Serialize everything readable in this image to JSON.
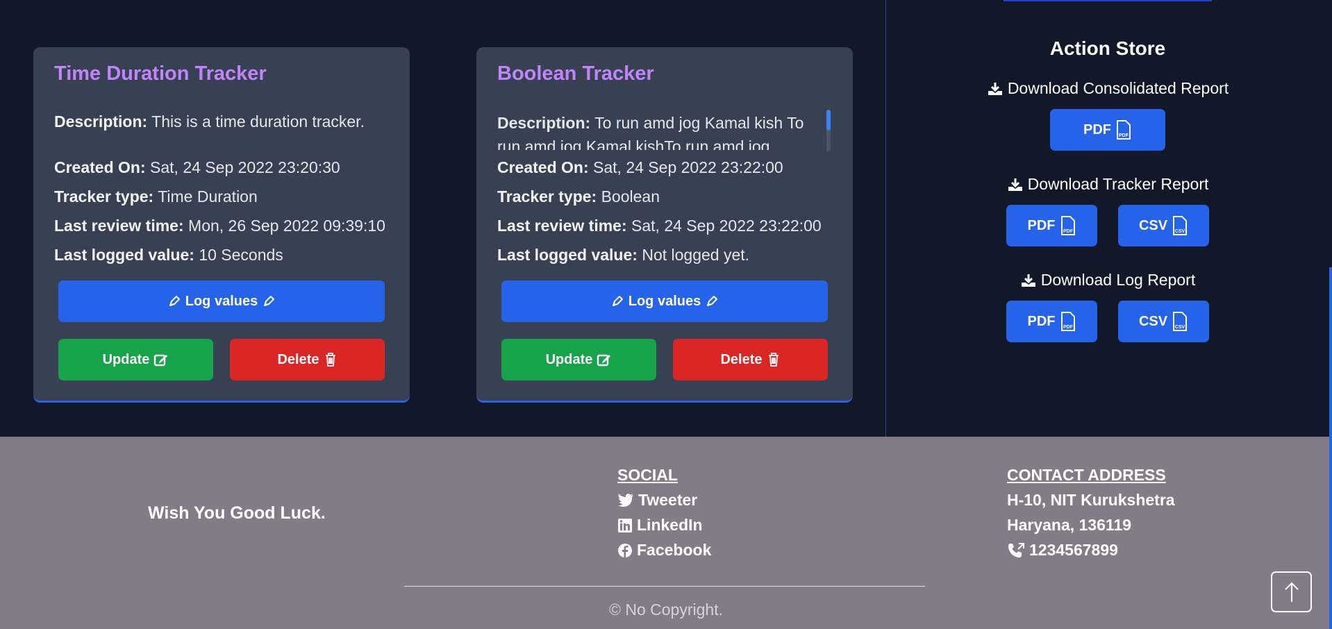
{
  "cards": [
    {
      "title": "Time Duration Tracker",
      "description_label": "Description:",
      "description": "This is a time duration tracker.",
      "created_label": "Created On:",
      "created": "Sat, 24 Sep 2022 23:20:30",
      "type_label": "Tracker type:",
      "type": "Time Duration",
      "review_label": "Last review time:",
      "review": "Mon, 26 Sep 2022 09:39:10",
      "logged_label": "Last logged value:",
      "logged": "10 Seconds",
      "log_button": "Log values",
      "update_button": "Update",
      "delete_button": "Delete"
    },
    {
      "title": "Boolean Tracker",
      "description_label": "Description:",
      "description": "To run amd jog Kamal kish To run amd jog Kamal kishTo run amd jog",
      "created_label": "Created On:",
      "created": "Sat, 24 Sep 2022 23:22:00",
      "type_label": "Tracker type:",
      "type": "Boolean",
      "review_label": "Last review time:",
      "review": "Sat, 24 Sep 2022 23:22:00",
      "logged_label": "Last logged value:",
      "logged": "Not logged yet.",
      "log_button": "Log values",
      "update_button": "Update",
      "delete_button": "Delete"
    }
  ],
  "action_store": {
    "title": "Action Store",
    "consolidated_label": "Download Consolidated Report",
    "tracker_label": "Download Tracker Report",
    "log_label": "Download Log Report",
    "pdf": "PDF",
    "csv": "CSV",
    "pdf_tag": "PDF",
    "csv_tag": "CSV"
  },
  "footer": {
    "tagline": "Wish You Good Luck.",
    "social_heading": "SOCIAL",
    "social": [
      "Tweeter",
      "LinkedIn",
      "Facebook"
    ],
    "contact_heading": "CONTACT ADDRESS",
    "address_line1": "H-10, NIT Kurukshetra",
    "address_line2": "Haryana, 136119",
    "phone": "1234567899",
    "copyright": "© No Copyright."
  },
  "colors": {
    "background": "#111827",
    "card": "#374151",
    "title_accent": "#c084fc",
    "primary": "#2563eb",
    "success": "#16a34a",
    "danger": "#dc2626",
    "footer": "#817c87"
  }
}
